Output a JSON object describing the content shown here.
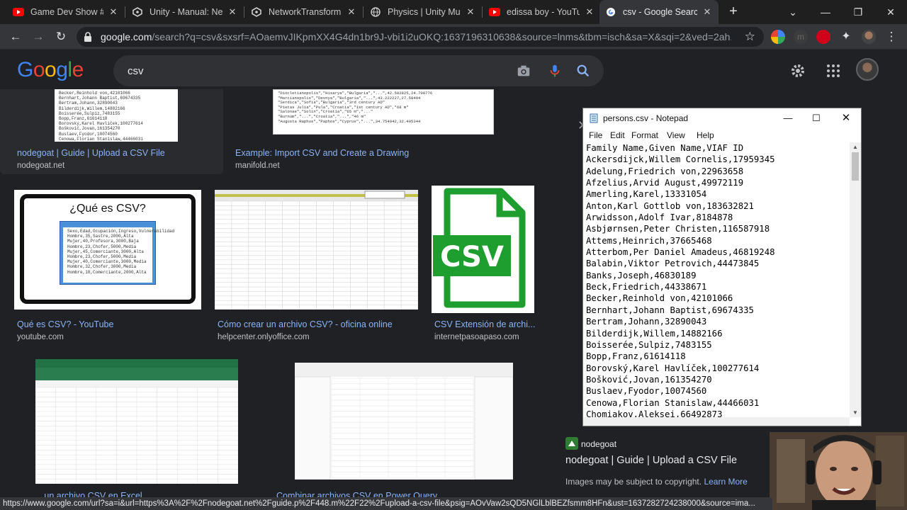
{
  "browser": {
    "tabs": [
      {
        "title": "Game Dev Show #",
        "favicon": "youtube-icon",
        "color": "#ff0000"
      },
      {
        "title": "Unity - Manual: Ne",
        "favicon": "unity-icon",
        "color": "#cfcfcf"
      },
      {
        "title": "NetworkTransform",
        "favicon": "unity-icon",
        "color": "#cfcfcf"
      },
      {
        "title": "Physics | Unity Mul",
        "favicon": "globe-icon",
        "color": "#cfcfcf"
      },
      {
        "title": "edissa boy - YouTu",
        "favicon": "youtube-icon",
        "color": "#ff0000"
      },
      {
        "title": "csv - Google Search",
        "favicon": "google-icon",
        "color": "#ffffff",
        "active": true
      }
    ],
    "url_host": "google.com",
    "url_rest": "/search?q=csv&sxsrf=AOaemvJIKpmXX4G4dn1br9J-vbi1i2uOKQ:1637196310638&source=lnms&tbm=isch&sa=X&sqi=2&ved=2ah..."
  },
  "google": {
    "logo": "Google",
    "query": "csv"
  },
  "results": [
    {
      "title": "nodegoat | Guide | Upload a CSV File",
      "source": "nodegoat.net"
    },
    {
      "title": "Example: Import CSV and Create a Drawing",
      "source": "manifold.net"
    },
    {
      "title": "Qué es CSV? - YouTube",
      "source": "youtube.com",
      "thumb_heading": "¿Qué es CSV?"
    },
    {
      "title": "Cómo crear un archivo CSV? - oficina online",
      "source": "helpcenter.onlyoffice.com"
    },
    {
      "title": "CSV Extensión de archi...",
      "source": "internetpasoapaso.com",
      "thumb_text": "CSV"
    },
    {
      "title": "...un archivo CSV en Excel",
      "source": ""
    },
    {
      "title": "Combinar archivos CSV en Power Query",
      "source": ""
    }
  ],
  "thumb_lines": {
    "nodegoat": [
      "Becker,Reinhold von,42101066",
      "Bernhart,Johann Baptist,69674335",
      "Bertram,Johann,32890043",
      "Bilderdijk,Willem,14882166",
      "Boisserée,Sulpiz,7483155",
      "Bopp,Franz,61614118",
      "Borovský,Karel Havlíček,100277614",
      "Bošković,Jovan,161354270",
      "Buslaev,Fyodor,10074560",
      "Cenowa,Florian Stanislaw,44466031"
    ],
    "manifold": [
      "\"Diocletianopolis\",\"Hisarya\",\"Bulgaria\",\"...\",42.502825,24.709776",
      "\"Marcianopolis\",\"Devnya\",\"Bulgaria\",\"...\",43.222227,27.58494",
      "\"Serdica\",\"Sofia\",\"Bulgaria\",\"3rd century AD\"",
      "\"Pietas Julia\",\"Pula\",\"Croatia\",\"1st century AD\",\"68 m\"",
      "\"Salonae\",\"Solin\",\"Croatia\",\"65 m\",\"...\"",
      "\"Burnum\",\"...\",\"Croatia\",\"...\",\"46 m\"",
      "\"Augusta Raphus\",\"Paphos\",\"Cyprus\",\"...\",34.754942,32.405344"
    ],
    "que_es": [
      "Sexo,Edad,Ocupación,Ingreso,Vulnerabilidad",
      "Hombre,35,Sastre,2000,Alta",
      "Mujer,40,Profesora,3000,Baja",
      "Hombre,23,Chofer,5000,Media",
      "Mujer,45,Comerciante,3000,Alta",
      "Hombre,23,Chofer,5000,Media",
      "Mujer,40,Comerciante,3000,Media",
      "Hombre,32,Chofer,3000,Media",
      "Hombre,18,Comerciante,2000,Alta"
    ]
  },
  "notepad": {
    "title": "persons.csv - Notepad",
    "menu": [
      "File",
      "Edit",
      "Format",
      "View",
      "Help"
    ],
    "lines": [
      "Family Name,Given Name,VIAF ID",
      "Ackersdijck,Willem Cornelis,17959345",
      "Adelung,Friedrich von,22963658",
      "Afzelius,Arvid August,49972119",
      "Amerling,Karel,13331054",
      "Anton,Karl Gottlob von,183632821",
      "Arwidsson,Adolf Ivar,8184878",
      "Asbjørnsen,Peter Christen,116587918",
      "Attems,Heinrich,37665468",
      "Atterbom,Per Daniel Amadeus,46819248",
      "Balabin,Viktor Petrovich,44473845",
      "Banks,Joseph,46830189",
      "Beck,Friedrich,44338671",
      "Becker,Reinhold von,42101066",
      "Bernhart,Johann Baptist,69674335",
      "Bertram,Johann,32890043",
      "Bilderdijk,Willem,14882166",
      "Boisserée,Sulpiz,7483155",
      "Bopp,Franz,61614118",
      "Borovský,Karel Havlíček,100277614",
      "Bošković,Jovan,161354270",
      "Buslaev,Fyodor,10074560",
      "Cenowa,Florian Stanislaw,44466031",
      "Chomiakov,Aleksei,66492873"
    ]
  },
  "preview": {
    "source": "nodegoat",
    "title": "nodegoat | Guide | Upload a CSV File",
    "copyright": "Images may be subject to copyright.",
    "learn_more": "Learn More"
  },
  "status_url": "https://www.google.com/url?sa=i&url=https%3A%2F%2Fnodegoat.net%2Fguide.p%2F448.m%22F22%2Fupload-a-csv-file&psig=AOvVaw2sQD5NGlLblBEZfsmm8HFn&ust=1637282724238000&source=ima..."
}
